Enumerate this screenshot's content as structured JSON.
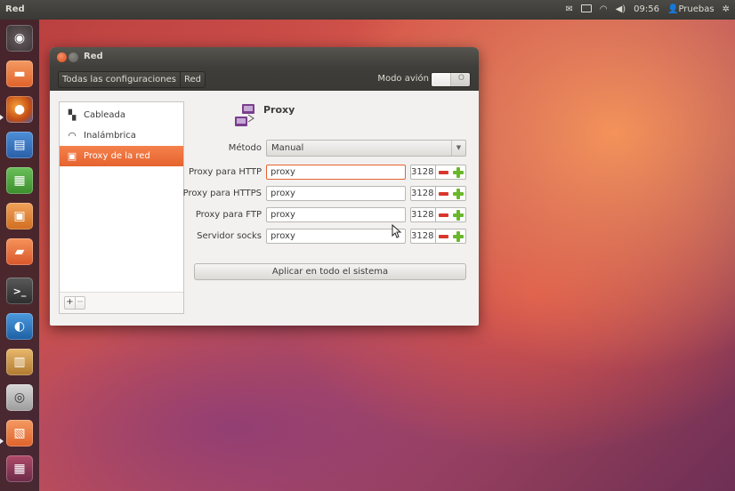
{
  "top_panel": {
    "app_title": "Red",
    "time": "09:56",
    "user": "Pruebas",
    "indicators": [
      "mail-icon",
      "keyboard-icon",
      "wifi-icon",
      "volume-icon",
      "user-icon",
      "gear-icon"
    ]
  },
  "launcher": {
    "items": [
      "ubuntu-dash",
      "files",
      "firefox",
      "libreoffice-writer",
      "libreoffice-calc",
      "libreoffice-impress",
      "ubuntu-software-center",
      "terminal",
      "shotwell",
      "archive",
      "camera",
      "update-manager",
      "workspace-switcher"
    ]
  },
  "window": {
    "title": "Red",
    "breadcrumb": [
      "Todas las configuraciones",
      "Red"
    ],
    "airplane_mode_label": "Modo avión",
    "airplane_switch_off_label": "O"
  },
  "sidebar": {
    "items": [
      {
        "label": "Cableada",
        "icon": "wired-network-icon"
      },
      {
        "label": "Inalámbrica",
        "icon": "wireless-icon"
      },
      {
        "label": "Proxy de la red",
        "icon": "network-proxy-icon",
        "selected": true
      }
    ],
    "add_label": "+",
    "remove_label": "−"
  },
  "proxy": {
    "title": "Proxy",
    "method_label": "Método",
    "method_value": "Manual",
    "rows": [
      {
        "label": "Proxy para HTTP",
        "host": "proxy",
        "port": "3128"
      },
      {
        "label": "Proxy para HTTPS",
        "host": "proxy",
        "port": "3128"
      },
      {
        "label": "Proxy para FTP",
        "host": "proxy",
        "port": "3128"
      },
      {
        "label": "Servidor socks",
        "host": "proxy",
        "port": "3128"
      }
    ],
    "apply_label": "Aplicar en todo el sistema"
  },
  "colors": {
    "accent_orange": "#e5632f",
    "close_button": "#dd4814",
    "panel_dark": "#3c3b37"
  }
}
